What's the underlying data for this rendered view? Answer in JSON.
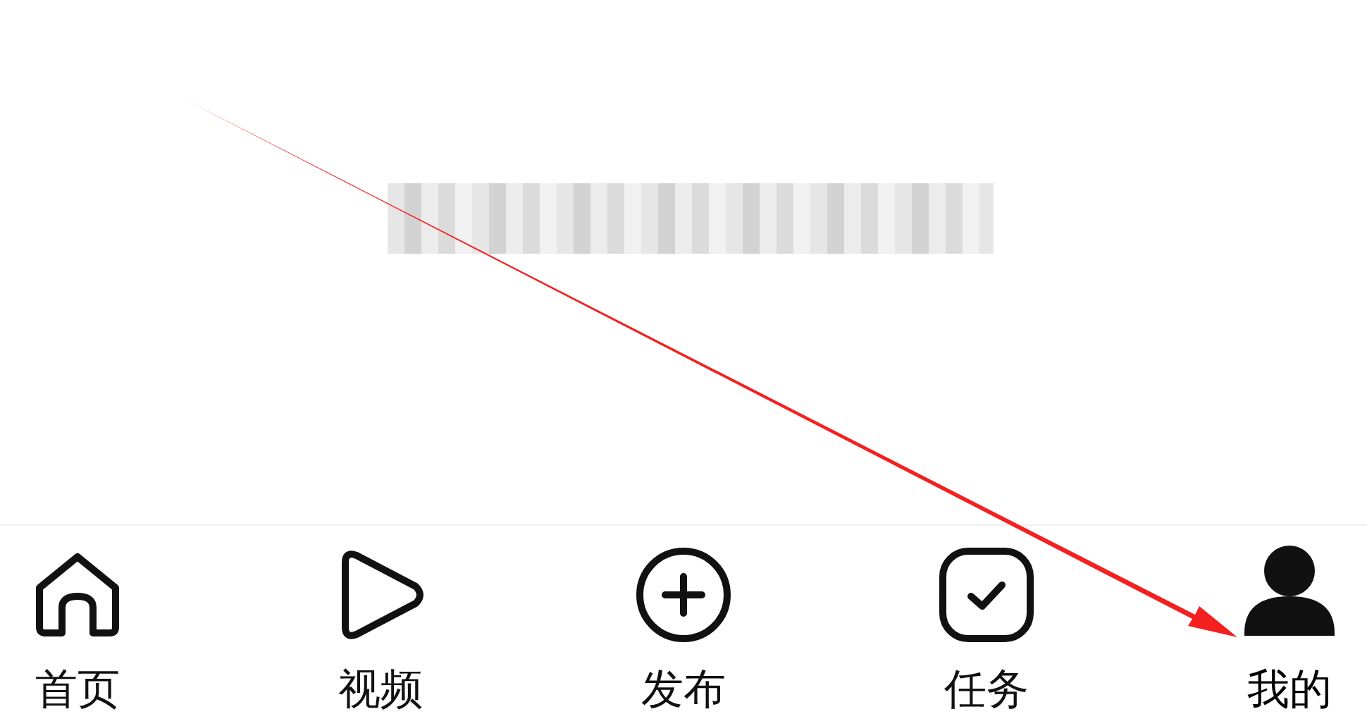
{
  "tab_bar": {
    "tabs": [
      {
        "label": "首页",
        "kind": "home",
        "selected": false
      },
      {
        "label": "视频",
        "kind": "video",
        "selected": false
      },
      {
        "label": "发布",
        "kind": "publish",
        "selected": false
      },
      {
        "label": "任务",
        "kind": "task",
        "selected": false
      },
      {
        "label": "我的",
        "kind": "profile",
        "selected": true
      }
    ]
  }
}
